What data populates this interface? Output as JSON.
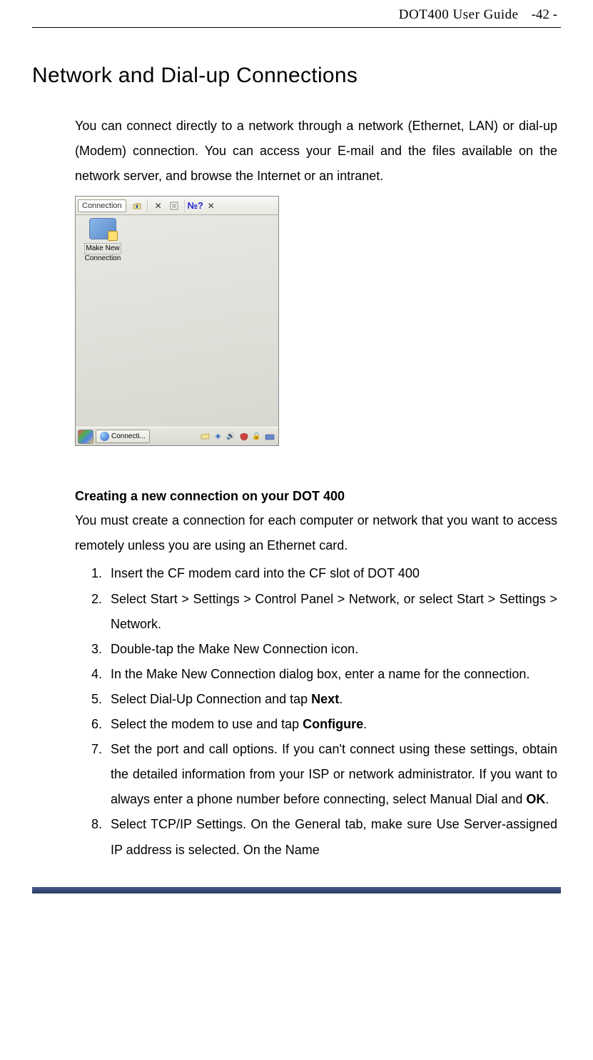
{
  "header": {
    "guide": "DOT400 User Guide",
    "page": "-42 -"
  },
  "title": "Network and Dial-up Connections",
  "intro": "You can connect directly to a network through a network (Ethernet, LAN) or dial-up (Modem) connection. You can access your E-mail and the files available on the network server, and browse the Internet or an intranet.",
  "screenshot": {
    "toolbar_title": "Connection",
    "icon_label_1": "Make New",
    "icon_label_2": "Connection",
    "taskbar_task": "Connecti..."
  },
  "section_heading": "Creating a new connection on your DOT 400",
  "sub_intro": "You must create a connection for each computer or network that you want to access remotely unless you are using an Ethernet card.",
  "steps": [
    "Insert the CF modem card into the CF slot of DOT 400",
    "Select Start > Settings > Control Panel > Network, or select Start > Settings > Network.",
    "Double-tap the Make New Connection icon.",
    "In the Make New Connection dialog box, enter a name for the connection.",
    "Select Dial-Up Connection and tap ",
    "Select the modem to use and tap ",
    "Set the port and call options. If you can't connect using these settings, obtain the detailed information from your ISP or network administrator. If you want to always enter a phone number before connecting, select Manual Dial and ",
    "Select TCP/IP Settings. On the General tab, make sure Use Server-assigned IP address is selected. On the Name"
  ],
  "bold": {
    "next": "Next",
    "configure": "Configure",
    "ok": "OK"
  }
}
